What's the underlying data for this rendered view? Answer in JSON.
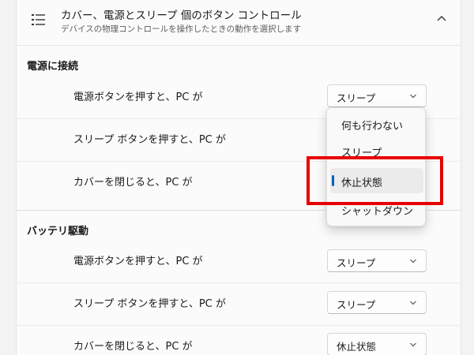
{
  "header": {
    "title": "カバー、電源とスリープ 個のボタン コントロール",
    "subtitle": "デバイスの物理コントロールを操作したときの動作を選択します",
    "icon": "list-icon",
    "collapse_icon": "chevron-up-icon"
  },
  "sections": {
    "plugged_in": {
      "title": "電源に接続",
      "rows": [
        {
          "label": "電源ボタンを押すと、PC が",
          "value": "スリープ"
        },
        {
          "label": "スリープ ボタンを押すと、PC が",
          "value": ""
        },
        {
          "label": "カバーを閉じると、PC が",
          "value": ""
        }
      ]
    },
    "battery": {
      "title": "バッテリ駆動",
      "rows": [
        {
          "label": "電源ボタンを押すと、PC が",
          "value": "スリープ"
        },
        {
          "label": "スリープ ボタンを押すと、PC が",
          "value": "スリープ"
        },
        {
          "label": "カバーを閉じると、PC が",
          "value": "休止状態"
        }
      ]
    }
  },
  "dropdown": {
    "options": [
      "何も行わない",
      "スリープ",
      "休止状態",
      "シャットダウン"
    ],
    "selected": "休止状態"
  },
  "colors": {
    "accent": "#005fb8",
    "highlight_box": "#e80000"
  }
}
